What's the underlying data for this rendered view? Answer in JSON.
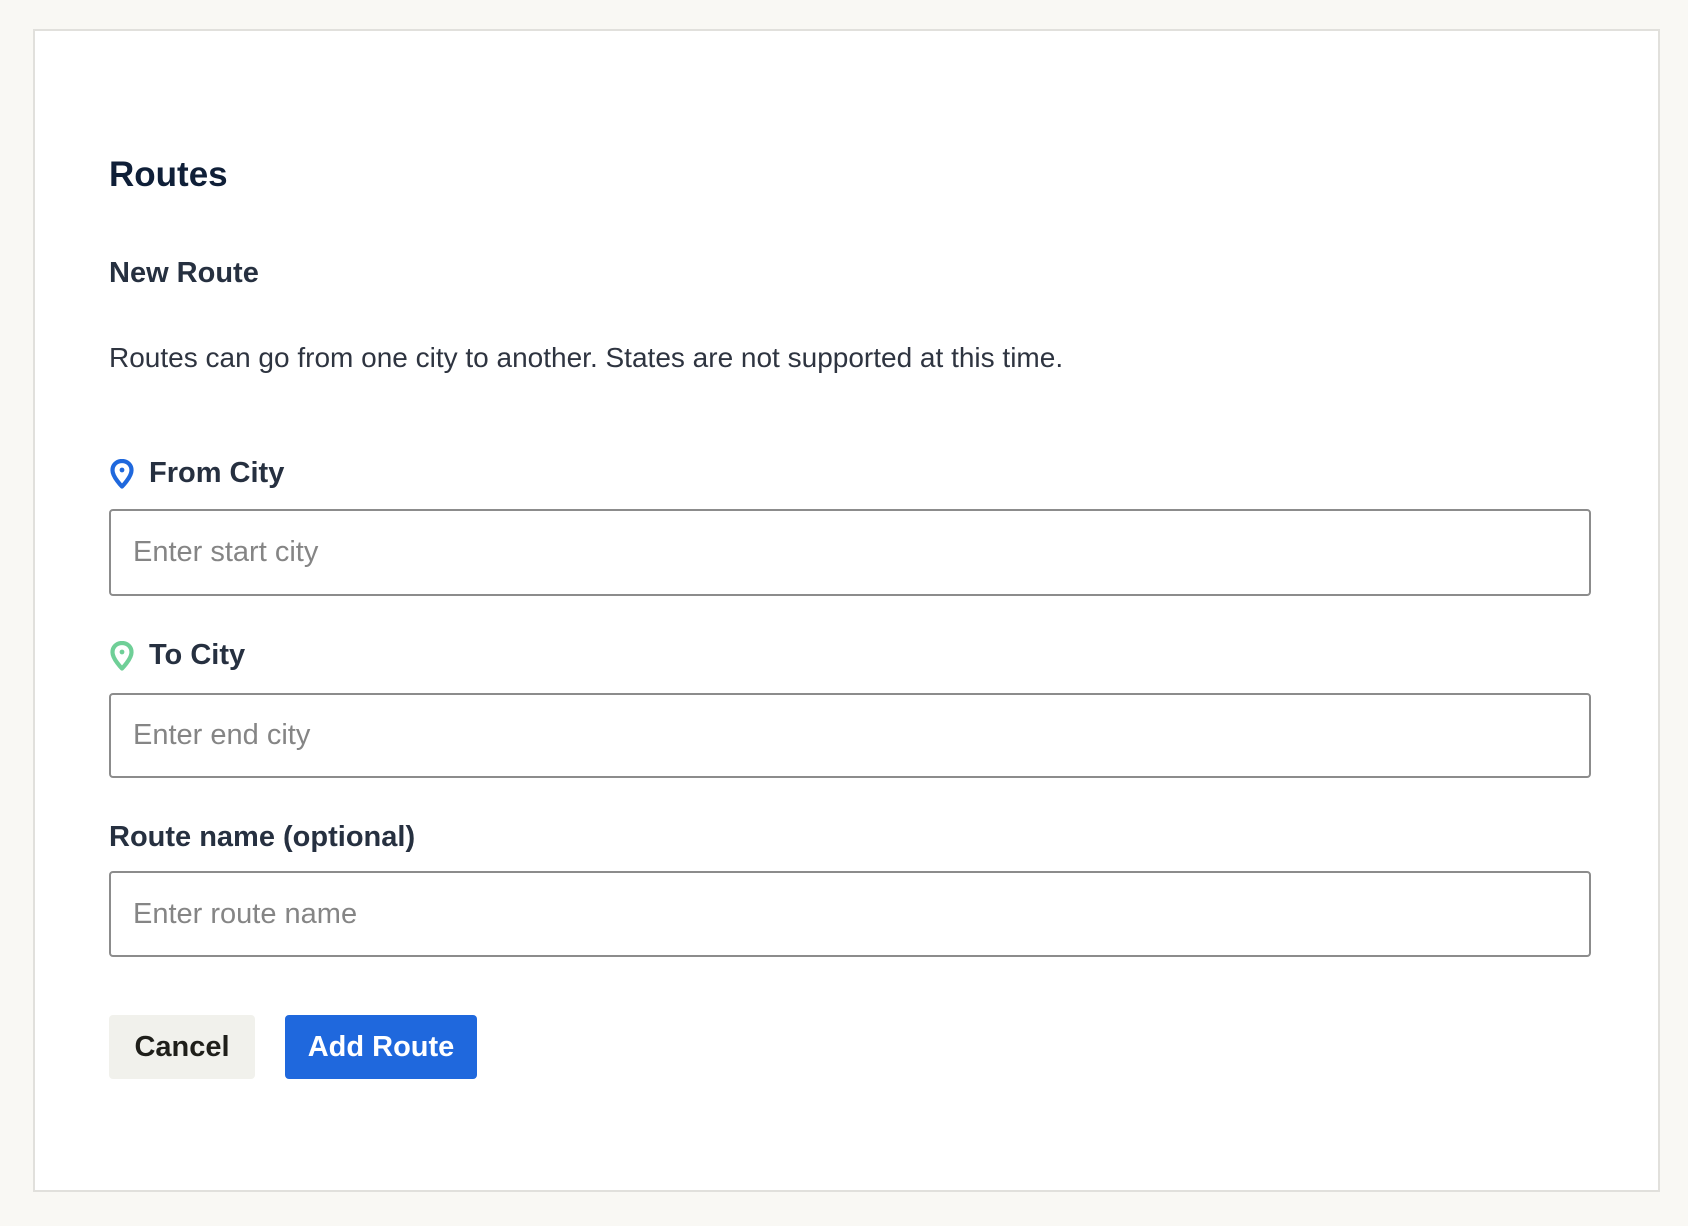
{
  "page": {
    "title": "Routes"
  },
  "form": {
    "section_title": "New Route",
    "description": "Routes can go from one city to another. States are not supported at this time.",
    "from_city": {
      "label": "From City",
      "placeholder": "Enter start city",
      "value": "",
      "icon": "map-pin-icon",
      "icon_color": "#1f68dd"
    },
    "to_city": {
      "label": "To City",
      "placeholder": "Enter end city",
      "value": "",
      "icon": "map-pin-icon",
      "icon_color": "#6fcf97"
    },
    "route_name": {
      "label": "Route name (optional)",
      "placeholder": "Enter route name",
      "value": ""
    },
    "cancel_label": "Cancel",
    "submit_label": "Add Route"
  },
  "colors": {
    "background": "#f9f8f4",
    "card": "#ffffff",
    "primary": "#1f68dd",
    "secondary_button": "#f1f1ec",
    "title_text": "#0f1f38"
  }
}
